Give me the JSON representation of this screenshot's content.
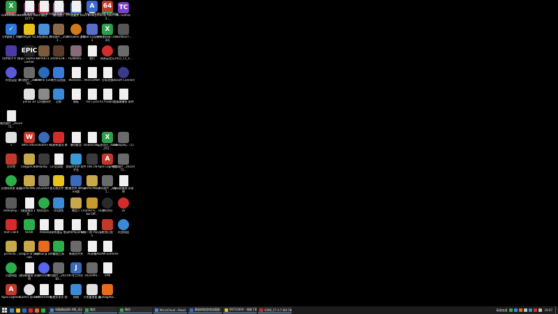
{
  "desktop": {
    "icons": [
      {
        "label": "e3b1d4d8c6...",
        "color": "#c0392b",
        "glyph": "",
        "shape": ""
      },
      {
        "label": "DANMAKU ABSPECT V",
        "color": "#6b2d5c",
        "glyph": "",
        "shape": ""
      },
      {
        "label": "情侣",
        "color": "#b03030",
        "glyph": "",
        "shape": ""
      },
      {
        "label": "腾讯图片",
        "color": "#8a5b9b",
        "glyph": "",
        "shape": ""
      },
      {
        "label": "个人收藏夹 2021",
        "color": "#3d7bd4",
        "glyph": "",
        "shape": ""
      },
      {
        "label": "Binary",
        "color": "#d0d0d0",
        "glyph": "",
        "shape": "round"
      },
      {
        "label": "2021年 6037903...",
        "color": "#2e9e4a",
        "glyph": "X",
        "shape": ""
      },
      {
        "label": "TC Games",
        "color": "#7b3fc6",
        "glyph": "TC",
        "shape": ""
      },
      {
        "label": "飞书客服工 作站",
        "color": "#2f78d8",
        "glyph": "✓",
        "shape": ""
      },
      {
        "label": "PotPlayer 64 bit",
        "color": "#e8c21c",
        "glyph": "",
        "shape": ""
      },
      {
        "label": "回收站",
        "color": "#4a90d9",
        "glyph": "",
        "shape": ""
      },
      {
        "label": "腾讯图片 _2021...",
        "color": "#8a6a4a",
        "glyph": "",
        "shape": ""
      },
      {
        "label": "WeGame 游戏",
        "color": "#d07a1c",
        "glyph": "",
        "shape": "round"
      },
      {
        "label": "Cheat Engine 7.3",
        "color": "#5a6ec8",
        "glyph": "",
        "shape": ""
      },
      {
        "label": "分析素材表 (10730)",
        "color": "#2e9e4a",
        "glyph": "X",
        "shape": ""
      },
      {
        "label": "2a2f662f7...",
        "color": "#555555",
        "glyph": "",
        "shape": ""
      },
      {
        "label": "同步助手平 台",
        "color": "#4a3aa8",
        "glyph": "",
        "shape": ""
      },
      {
        "label": "Epic Games Launcher",
        "color": "#222222",
        "glyph": "EPIC",
        "shape": ""
      },
      {
        "label": "v2-9c873...",
        "color": "#7a5c3a",
        "glyph": "",
        "shape": ""
      },
      {
        "label": "34560128...",
        "color": "#5c3a2a",
        "glyph": "",
        "shape": ""
      },
      {
        "label": "f428bfd5...",
        "color": "#8a6a7a",
        "glyph": "",
        "shape": ""
      },
      {
        "label": "我们",
        "color": "#f0f0f0",
        "glyph": "",
        "shape": "doc"
      },
      {
        "label": "网易云音乐",
        "color": "#d42c2c",
        "glyph": "",
        "shape": "round"
      },
      {
        "label": "2021_11_1...",
        "color": "#6a6a6a",
        "glyph": "",
        "shape": ""
      },
      {
        "label": "阿里云盘",
        "color": "#5a5ad8",
        "glyph": "",
        "shape": "round"
      },
      {
        "label": "腾讯图片 _2021050...",
        "color": "#6a6a6a",
        "glyph": "",
        "shape": ""
      },
      {
        "label": "Xtreme Tuner",
        "color": "#2a6ab8",
        "glyph": "",
        "shape": "round"
      },
      {
        "label": "钉钉远程桌",
        "color": "#3a7ad8",
        "glyph": "",
        "shape": ""
      },
      {
        "label": "Warzone...",
        "color": "#f0f0f0",
        "glyph": "",
        "shape": "doc"
      },
      {
        "label": "Mikro5M4A",
        "color": "#f0f0f0",
        "glyph": "",
        "shape": "doc"
      },
      {
        "label": "分享消息",
        "color": "#f0f0f0",
        "glyph": "",
        "shape": "doc"
      },
      {
        "label": "Ubisoft Connect",
        "color": "#3a3a8a",
        "glyph": "",
        "shape": "round"
      },
      {
        "label": "",
        "color": "#000000",
        "glyph": "",
        "shape": "none"
      },
      {
        "label": "perna 3d",
        "color": "#e0e0e0",
        "glyph": "",
        "shape": ""
      },
      {
        "label": "以问题研究",
        "color": "#8a8a8a",
        "glyph": "",
        "shape": ""
      },
      {
        "label": "企鹅",
        "color": "#3a8ad8",
        "glyph": "",
        "shape": ""
      },
      {
        "label": "模板",
        "color": "#f0f0f0",
        "glyph": "",
        "shape": "doc"
      },
      {
        "label": "The Cycle",
        "color": "#f0f0f0",
        "glyph": "",
        "shape": "doc"
      },
      {
        "label": "X17f5eb9...",
        "color": "#f0f0f0",
        "glyph": "",
        "shape": "doc"
      },
      {
        "label": "超级聊赚钱 说明",
        "color": "#f0f0f0",
        "glyph": "",
        "shape": "doc"
      },
      {
        "label": "微信图片 _2022072...",
        "color": "#f0f0f0",
        "glyph": "",
        "shape": "doc"
      },
      {
        "label": "",
        "color": "#000000",
        "glyph": "",
        "shape": "none"
      },
      {
        "label": "",
        "color": "#000000",
        "glyph": "",
        "shape": "none"
      },
      {
        "label": "",
        "color": "#000000",
        "glyph": "",
        "shape": "none"
      },
      {
        "label": "",
        "color": "#000000",
        "glyph": "",
        "shape": "none"
      },
      {
        "label": "",
        "color": "#000000",
        "glyph": "",
        "shape": "none"
      },
      {
        "label": "",
        "color": "#000000",
        "glyph": "",
        "shape": "none"
      },
      {
        "label": "",
        "color": "#000000",
        "glyph": "",
        "shape": "none"
      },
      {
        "label": "1",
        "color": "#e0e0e0",
        "glyph": "",
        "shape": ""
      },
      {
        "label": "WPS Office",
        "color": "#c0392b",
        "glyph": "W",
        "shape": ""
      },
      {
        "label": "Steam++",
        "color": "#3a6ab8",
        "glyph": "",
        "shape": "round"
      },
      {
        "label": "网易有道词 典",
        "color": "#d42c2c",
        "glyph": "",
        "shape": ""
      },
      {
        "label": "暴风影音",
        "color": "#f0f0f0",
        "glyph": "",
        "shape": "doc"
      },
      {
        "label": "steamcom...",
        "color": "#f0f0f0",
        "glyph": "",
        "shape": "doc"
      },
      {
        "label": "云逐项目 _4DSK_011...",
        "color": "#2e9e4a",
        "glyph": "X",
        "shape": ""
      },
      {
        "label": "videoplay... (1)",
        "color": "#6a6a6a",
        "glyph": "",
        "shape": ""
      },
      {
        "label": "优学院",
        "color": "#c0392b",
        "glyph": "",
        "shape": ""
      },
      {
        "label": "LeagueCli...",
        "color": "#c8a84a",
        "glyph": "",
        "shape": ""
      },
      {
        "label": "videoplay... (2)",
        "color": "#3a3a3a",
        "glyph": "",
        "shape": ""
      },
      {
        "label": "全局版",
        "color": "#f0f0f0",
        "glyph": "",
        "shape": "doc"
      },
      {
        "label": "我家的世界 软件平台",
        "color": "#3a9ad8",
        "glyph": "",
        "shape": ""
      },
      {
        "label": "FBE CN",
        "color": "#3a3a3a",
        "glyph": "",
        "shape": ""
      },
      {
        "label": "Apex Legends",
        "color": "#c0392b",
        "glyph": "A",
        "shape": ""
      },
      {
        "label": "微信图片 _2022072...",
        "color": "#6a6a6a",
        "glyph": "",
        "shape": ""
      },
      {
        "label": "迅游网游加 速器",
        "color": "#2eae4a",
        "glyph": "",
        "shape": "round"
      },
      {
        "label": "perfectWo...",
        "color": "#c8a84a",
        "glyph": "",
        "shape": ""
      },
      {
        "label": "2022050...",
        "color": "#6a6a6a",
        "glyph": "",
        "shape": ""
      },
      {
        "label": "鱼丸视文件 夹",
        "color": "#e8c21c",
        "glyph": "",
        "shape": ""
      },
      {
        "label": "完美世界 WeGame版",
        "color": "#3a6ab8",
        "glyph": "",
        "shape": ""
      },
      {
        "label": "perfectWo...",
        "color": "#c8a84a",
        "glyph": "",
        "shape": ""
      },
      {
        "label": "腾讯图片 _2021...",
        "color": "#6a6a6a",
        "glyph": "",
        "shape": ""
      },
      {
        "label": "国际联盟测 试说明",
        "color": "#f0f0f0",
        "glyph": "",
        "shape": "doc"
      },
      {
        "label": "videoplay...",
        "color": "#5a5a5a",
        "glyph": "",
        "shape": ""
      },
      {
        "label": "【桌面推荐 】抖音...",
        "color": "#f0f0f0",
        "glyph": "",
        "shape": "doc"
      },
      {
        "label": "QQ音乐",
        "color": "#2eae4a",
        "glyph": "",
        "shape": "round"
      },
      {
        "label": "QQ游戏",
        "color": "#3a8ad8",
        "glyph": "",
        "shape": ""
      },
      {
        "label": "微信人",
        "color": "#c8a84a",
        "glyph": "",
        "shape": ""
      },
      {
        "label": "Counter-S... Global Off...",
        "color": "#c89a2a",
        "glyph": "",
        "shape": ""
      },
      {
        "label": "腾讯QQ",
        "color": "#2a2a2a",
        "glyph": "",
        "shape": "round"
      },
      {
        "label": "SV",
        "color": "#d42c2c",
        "glyph": "",
        "shape": "round"
      },
      {
        "label": "Riot Client",
        "color": "#d42c2c",
        "glyph": "",
        "shape": ""
      },
      {
        "label": "KOOK",
        "color": "#2eae4a",
        "glyph": "",
        "shape": ""
      },
      {
        "label": "Adobe",
        "color": "#f0f0f0",
        "glyph": "",
        "shape": "doc"
      },
      {
        "label": "网易有道云 笔记",
        "color": "#f0f0f0",
        "glyph": "",
        "shape": "doc"
      },
      {
        "label": "PotPlayer64",
        "color": "#f0f0f0",
        "glyph": "",
        "shape": "doc"
      },
      {
        "label": "网易一拍 Playlgen",
        "color": "#f0f0f0",
        "glyph": "",
        "shape": "doc"
      },
      {
        "label": "在线日程",
        "color": "#c0392b",
        "glyph": "",
        "shape": ""
      },
      {
        "label": "阿里网盘",
        "color": "#3a8ad8",
        "glyph": "",
        "shape": "round"
      },
      {
        "label": "perfecto...",
        "color": "#c8a84a",
        "glyph": "",
        "shape": ""
      },
      {
        "label": "League of Legends",
        "color": "#c8a84a",
        "glyph": "",
        "shape": ""
      },
      {
        "label": "Samsung Dett",
        "color": "#e86a1c",
        "glyph": "",
        "shape": ""
      },
      {
        "label": "截图工具",
        "color": "#2eae4a",
        "glyph": "",
        "shape": ""
      },
      {
        "label": "新建文件夹",
        "color": "#6a6a6a",
        "glyph": "",
        "shape": ""
      },
      {
        "label": "PE屏幕",
        "color": "#f0f0f0",
        "glyph": "",
        "shape": "doc"
      },
      {
        "label": "AIDAM Extreme",
        "color": "#f0f0f0",
        "glyph": "",
        "shape": "doc"
      },
      {
        "label": "",
        "color": "#000000",
        "glyph": "",
        "shape": "none"
      },
      {
        "label": "百度网盘",
        "color": "#2eae4a",
        "glyph": "",
        "shape": "round"
      },
      {
        "label": "国际联盟测 试说明",
        "color": "#f0f0f0",
        "glyph": "",
        "shape": "doc"
      },
      {
        "label": "Discord",
        "color": "#5865f2",
        "glyph": "",
        "shape": "round"
      },
      {
        "label": "腾讯图片 _2021082...",
        "color": "#6a6a6a",
        "glyph": "",
        "shape": ""
      },
      {
        "label": "千年工作台",
        "color": "#3a6ab8",
        "glyph": "J",
        "shape": ""
      },
      {
        "label": "2022090...",
        "color": "#6a6a6a",
        "glyph": "",
        "shape": ""
      },
      {
        "label": "VPN",
        "color": "#f0f0f0",
        "glyph": "",
        "shape": "doc"
      },
      {
        "label": "",
        "color": "#000000",
        "glyph": "",
        "shape": "none"
      },
      {
        "label": "Apex Legends",
        "color": "#c0392b",
        "glyph": "A",
        "shape": ""
      },
      {
        "label": "Camel Tycoon",
        "color": "#e0e0e0",
        "glyph": "",
        "shape": "round"
      },
      {
        "label": "FUNDFriend...",
        "color": "#f0f0f0",
        "glyph": "",
        "shape": "doc"
      },
      {
        "label": "新建文本文 档",
        "color": "#f0f0f0",
        "glyph": "",
        "shape": "doc"
      },
      {
        "label": "网络",
        "color": "#3a8ad8",
        "glyph": "",
        "shape": ""
      },
      {
        "label": "小黑盒加速 器",
        "color": "#e0e0e0",
        "glyph": "",
        "shape": ""
      },
      {
        "label": "EurkaglAD...",
        "color": "#e86a1c",
        "glyph": "",
        "shape": ""
      },
      {
        "label": "",
        "color": "#000000",
        "glyph": "",
        "shape": "none"
      },
      {
        "label": "鹰眼图片",
        "color": "#2e9e4a",
        "glyph": "X",
        "shape": ""
      },
      {
        "label": "dControl",
        "color": "#f0f0f0",
        "glyph": "",
        "shape": "doc"
      },
      {
        "label": "百叶窗",
        "color": "#f0f0f0",
        "glyph": "",
        "shape": "doc"
      },
      {
        "label": "乐视视频客 户端",
        "color": "#f0f0f0",
        "glyph": "",
        "shape": "doc"
      },
      {
        "label": "2022010...",
        "color": "#f0f0f0",
        "glyph": "",
        "shape": "doc"
      },
      {
        "label": "AnAsem...",
        "color": "#3a6ad8",
        "glyph": "A",
        "shape": ""
      },
      {
        "label": "AIDAM Extreme",
        "color": "#c0392b",
        "glyph": "64",
        "shape": ""
      },
      {
        "label": "",
        "color": "#000000",
        "glyph": "",
        "shape": "none"
      }
    ]
  },
  "taskbar": {
    "pinned_colors": [
      "#3a8ad8",
      "#f0c020",
      "#2a6ab8",
      "#d42c2c",
      "#e86a1c",
      "#2eae4a"
    ],
    "windows": [
      {
        "title": "电脑端连接6.0版_迅达...",
        "icon_color": "#3a8ad8"
      },
      {
        "title": "微信",
        "icon_color": "#2eae4a"
      },
      {
        "title": "微信",
        "icon_color": "#2eae4a"
      },
      {
        "title": "MicroCloud - Panel",
        "icon_color": "#3a8ad8"
      },
      {
        "title": "基础网络游戏加速器",
        "icon_color": "#3a6ad8"
      },
      {
        "title": "BST33000 - 电脑下载...",
        "icon_color": "#e8c21c"
      },
      {
        "title": "V280_17.1.7.8/4 5B...",
        "icon_color": "#d42c2c"
      }
    ],
    "tray": {
      "label": "高速加速",
      "time": "19:07",
      "icon_colors": [
        "#2eae4a",
        "#3a8ad8",
        "#e86a1c",
        "#c0c0c0",
        "#3a8ad8",
        "#d42c2c",
        "#c0c0c0"
      ]
    }
  }
}
